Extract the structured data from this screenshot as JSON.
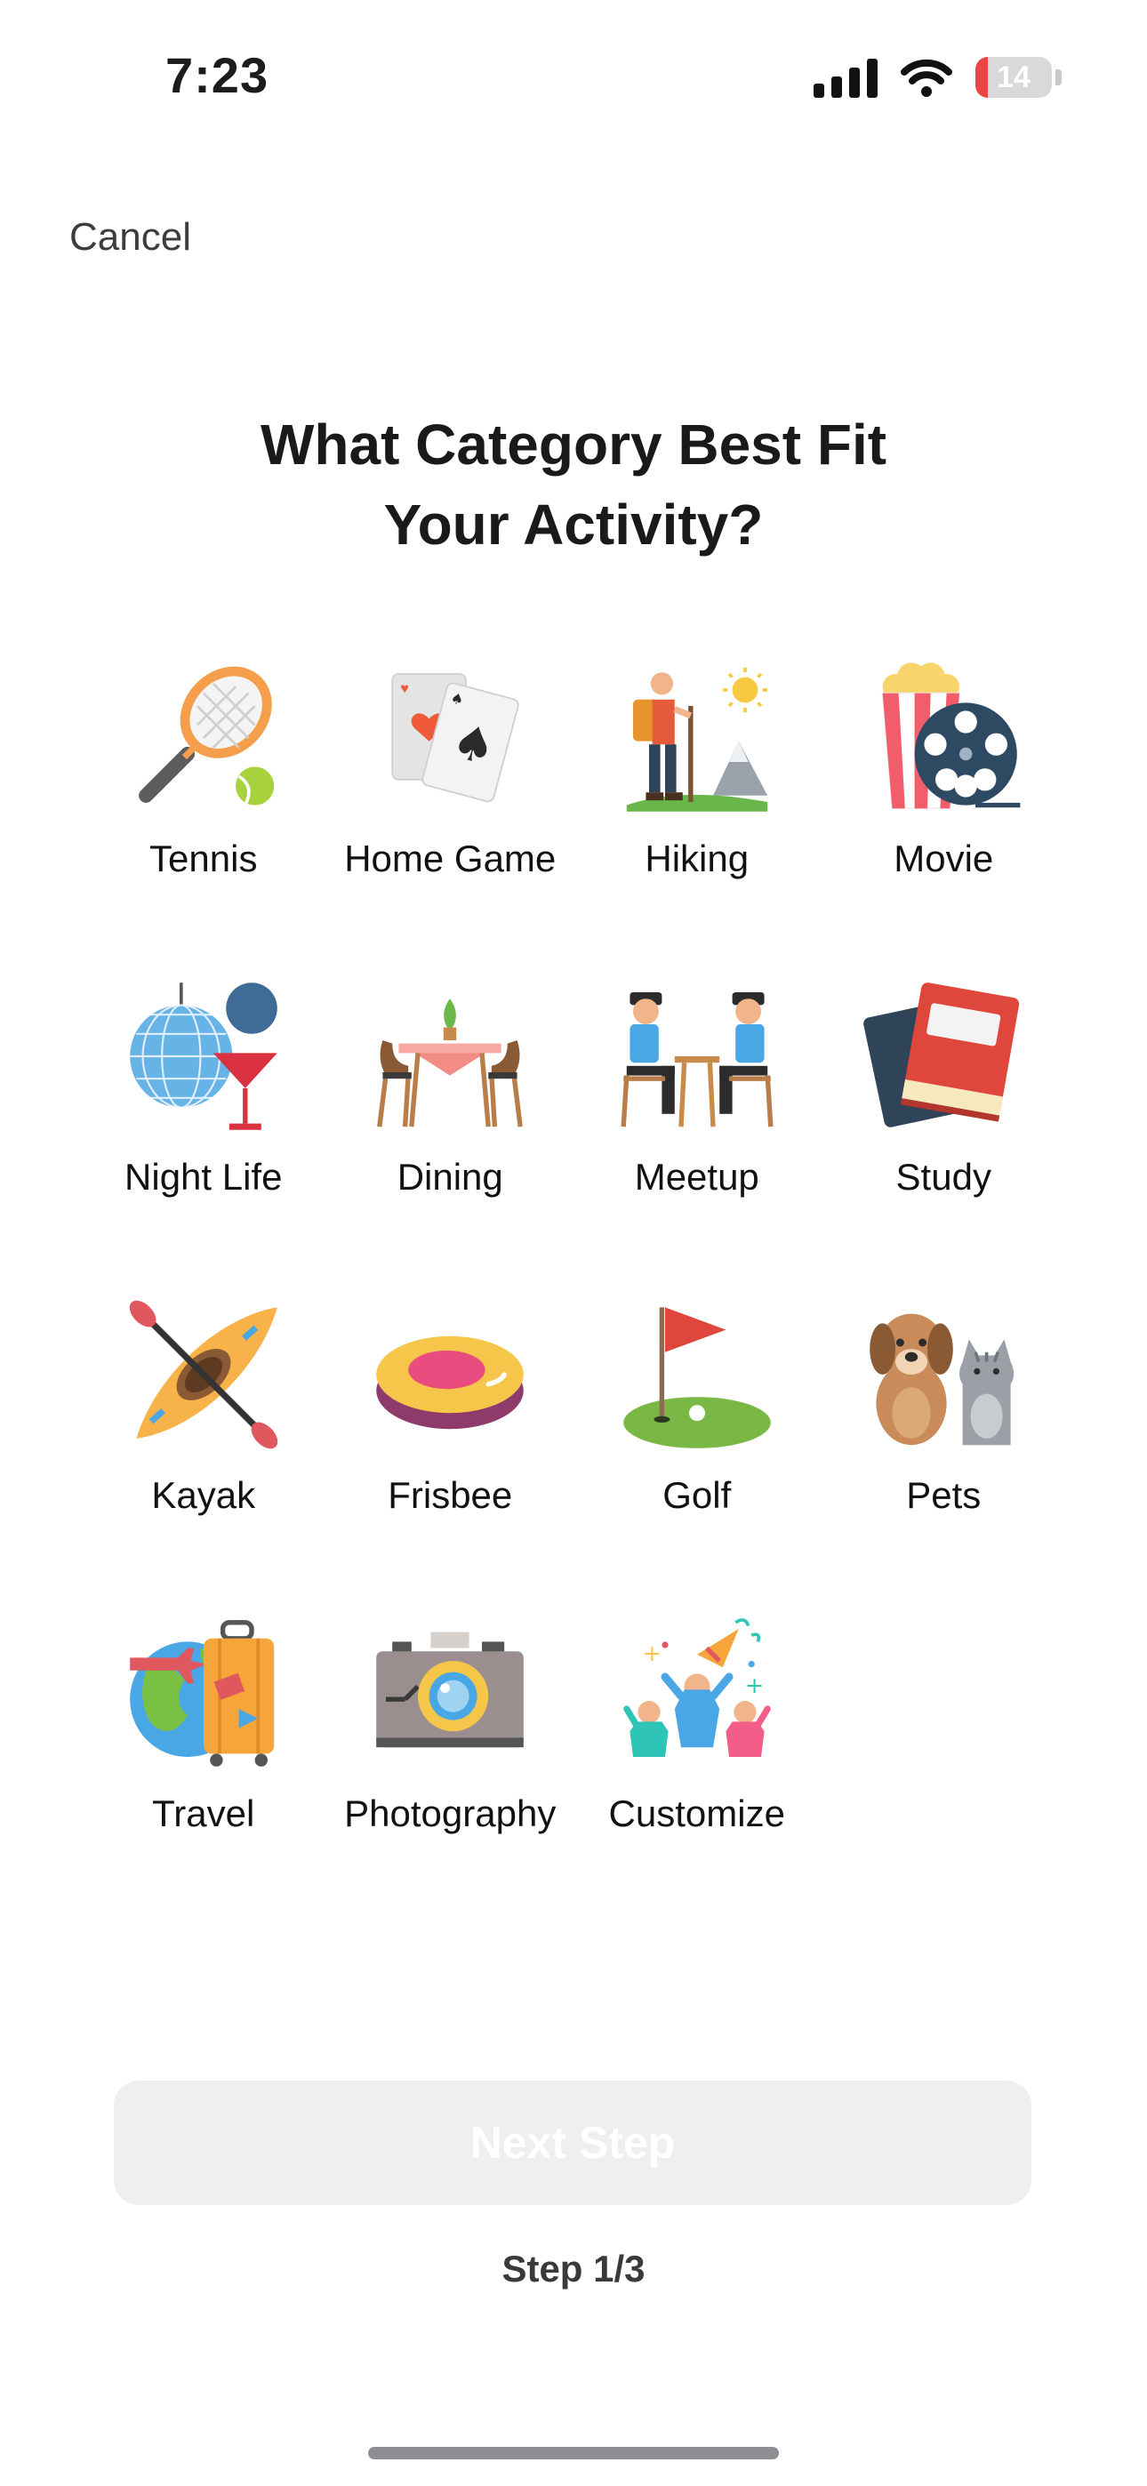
{
  "status": {
    "time": "7:23",
    "battery": "14",
    "battery_color": "#eb4646"
  },
  "header": {
    "cancel_label": "Cancel"
  },
  "title_line1": "What Category Best Fit",
  "title_line2": "Your Activity?",
  "categories": [
    {
      "label": "Tennis",
      "icon": "tennis-icon"
    },
    {
      "label": "Home Game",
      "icon": "playing-cards-icon"
    },
    {
      "label": "Hiking",
      "icon": "hiker-icon"
    },
    {
      "label": "Movie",
      "icon": "film-reel-popcorn-icon"
    },
    {
      "label": "Night Life",
      "icon": "disco-ball-cocktail-icon"
    },
    {
      "label": "Dining",
      "icon": "dining-table-icon"
    },
    {
      "label": "Meetup",
      "icon": "meetup-people-icon"
    },
    {
      "label": "Study",
      "icon": "books-icon"
    },
    {
      "label": "Kayak",
      "icon": "kayak-icon"
    },
    {
      "label": "Frisbee",
      "icon": "frisbee-icon"
    },
    {
      "label": "Golf",
      "icon": "golf-flag-icon"
    },
    {
      "label": "Pets",
      "icon": "dog-cat-icon"
    },
    {
      "label": "Travel",
      "icon": "globe-luggage-icon"
    },
    {
      "label": "Photography",
      "icon": "camera-icon"
    },
    {
      "label": "Customize",
      "icon": "party-people-icon"
    }
  ],
  "footer": {
    "next_label": "Next Step",
    "step_label": "Step 1/3"
  }
}
